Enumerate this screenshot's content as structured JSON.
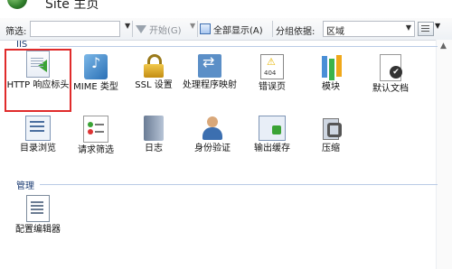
{
  "window": {
    "title": "Site 主页"
  },
  "toolbar": {
    "filter_label": "筛选:",
    "filter_value": "",
    "start_label": "开始(G)",
    "show_all_label": "全部显示(A)",
    "group_by_label": "分组依据:",
    "group_by_value": "区域"
  },
  "groups": [
    {
      "label": "IIS"
    },
    {
      "label": "管理"
    }
  ],
  "features": {
    "http_headers": "HTTP 响应标头",
    "mime_types": "MIME 类型",
    "ssl": "SSL 设置",
    "handler_mappings": "处理程序映射",
    "error_pages": "错误页",
    "modules": "模块",
    "default_document": "默认文档",
    "directory_browsing": "目录浏览",
    "request_filtering": "请求筛选",
    "logging": "日志",
    "authentication": "身份验证",
    "output_caching": "输出缓存",
    "compression": "压缩",
    "config_editor": "配置编辑器"
  },
  "selected_feature": "HTTP 响应标头"
}
